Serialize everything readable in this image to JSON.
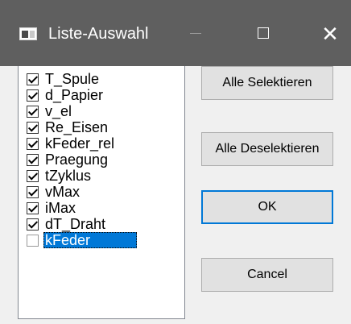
{
  "window": {
    "title": "Liste-Auswahl",
    "close_glyph": "✕"
  },
  "list": {
    "items": [
      {
        "label": "T_Spule",
        "checked": true
      },
      {
        "label": "d_Papier",
        "checked": true
      },
      {
        "label": "v_el",
        "checked": true
      },
      {
        "label": "Re_Eisen",
        "checked": true
      },
      {
        "label": "kFeder_rel",
        "checked": true
      },
      {
        "label": "Praegung",
        "checked": true
      },
      {
        "label": "tZyklus",
        "checked": true
      },
      {
        "label": "vMax",
        "checked": true
      },
      {
        "label": "iMax",
        "checked": true
      },
      {
        "label": "dT_Draht",
        "checked": true
      },
      {
        "label": "kFeder",
        "checked": false,
        "selected": true
      }
    ]
  },
  "buttons": {
    "select_all": "Alle Selektieren",
    "deselect_all": "Alle Deselektieren",
    "ok": "OK",
    "cancel": "Cancel"
  },
  "colors": {
    "titlebar": "#5f5f5f",
    "selection": "#0078d7",
    "window_bg": "#f0f0f0"
  }
}
